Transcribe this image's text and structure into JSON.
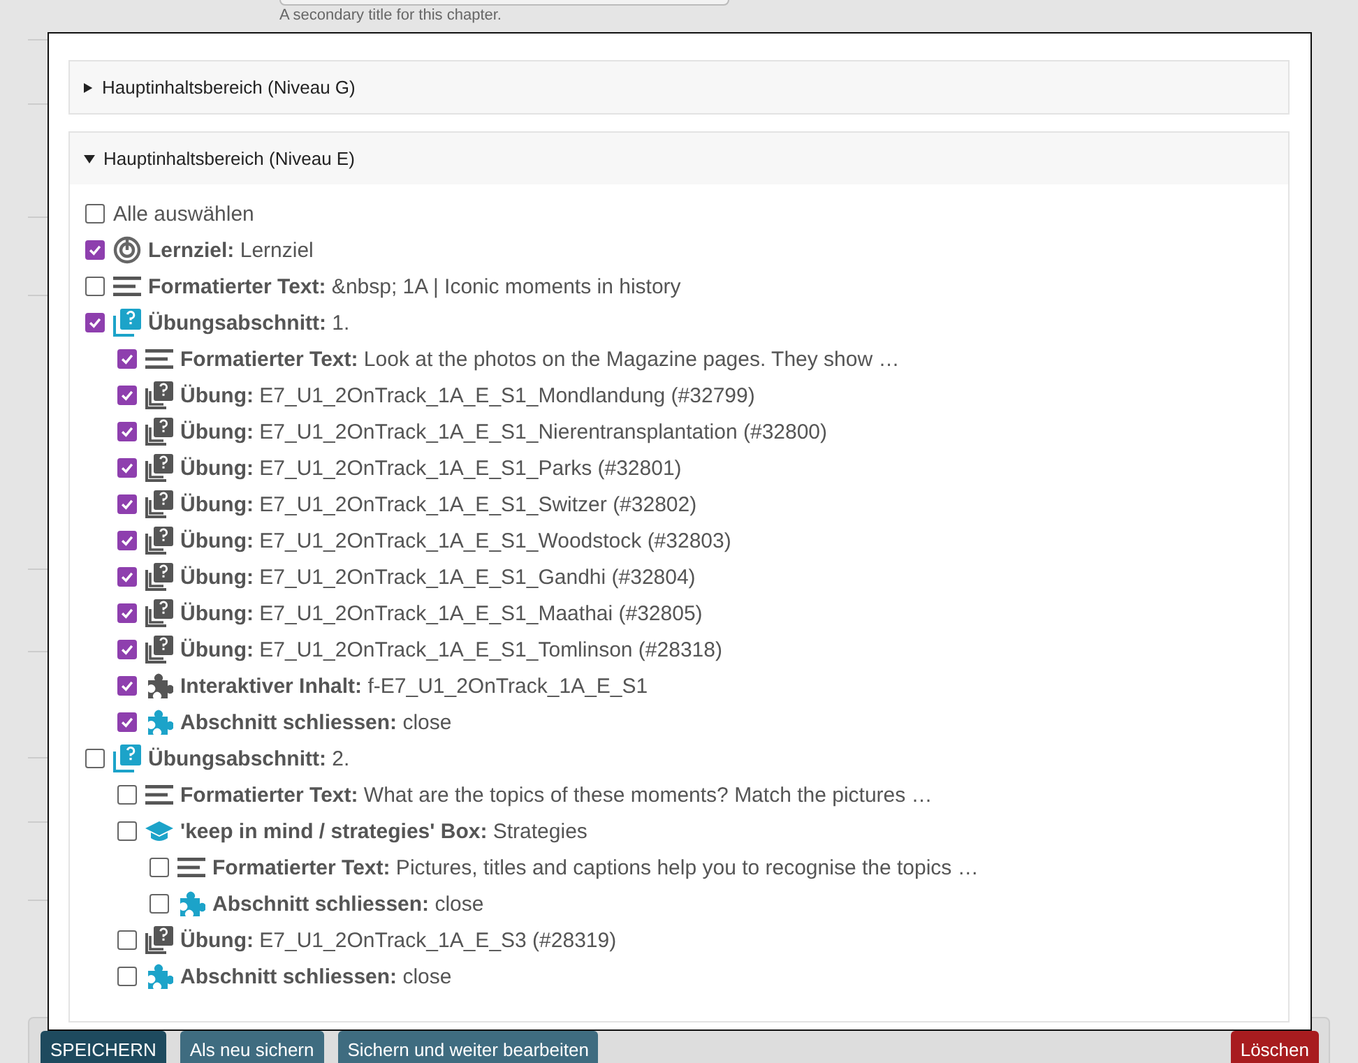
{
  "background": {
    "field_hint": "A secondary title for this chapter."
  },
  "dialog": {
    "sections": [
      {
        "title": "Hauptinhaltsbereich (Niveau G)",
        "expanded": false
      },
      {
        "title": "Hauptinhaltsbereich (Niveau E)",
        "expanded": true,
        "select_all": {
          "label": "Alle auswählen",
          "checked": false
        },
        "items": [
          {
            "kind": "learning-goal",
            "label": "Lernziel:",
            "value": "Lernziel",
            "checked": true
          },
          {
            "kind": "text",
            "label": "Formatierter Text:",
            "value": "&nbsp; 1A | Iconic moments in history",
            "checked": false
          },
          {
            "kind": "section",
            "label": "Übungsabschnitt:",
            "value": "1.",
            "checked": true,
            "children": [
              {
                "kind": "text",
                "label": "Formatierter Text:",
                "value": "Look at the photos on the Magazine pages. They show …",
                "checked": true
              },
              {
                "kind": "exercise",
                "label": "Übung:",
                "value": "E7_U1_2OnTrack_1A_E_S1_Mondlandung (#32799)",
                "checked": true
              },
              {
                "kind": "exercise",
                "label": "Übung:",
                "value": "E7_U1_2OnTrack_1A_E_S1_Nierentransplantation (#32800)",
                "checked": true
              },
              {
                "kind": "exercise",
                "label": "Übung:",
                "value": "E7_U1_2OnTrack_1A_E_S1_Parks (#32801)",
                "checked": true
              },
              {
                "kind": "exercise",
                "label": "Übung:",
                "value": "E7_U1_2OnTrack_1A_E_S1_Switzer (#32802)",
                "checked": true
              },
              {
                "kind": "exercise",
                "label": "Übung:",
                "value": "E7_U1_2OnTrack_1A_E_S1_Woodstock (#32803)",
                "checked": true
              },
              {
                "kind": "exercise",
                "label": "Übung:",
                "value": "E7_U1_2OnTrack_1A_E_S1_Gandhi (#32804)",
                "checked": true
              },
              {
                "kind": "exercise",
                "label": "Übung:",
                "value": "E7_U1_2OnTrack_1A_E_S1_Maathai (#32805)",
                "checked": true
              },
              {
                "kind": "exercise",
                "label": "Übung:",
                "value": "E7_U1_2OnTrack_1A_E_S1_Tomlinson (#28318)",
                "checked": true
              },
              {
                "kind": "interactive",
                "label": "Interaktiver Inhalt:",
                "value": "f-E7_U1_2OnTrack_1A_E_S1",
                "checked": true
              },
              {
                "kind": "close",
                "label": "Abschnitt schliessen:",
                "value": "close",
                "checked": true
              }
            ]
          },
          {
            "kind": "section",
            "label": "Übungsabschnitt:",
            "value": "2.",
            "checked": false,
            "children": [
              {
                "kind": "text",
                "label": "Formatierter Text:",
                "value": "What are the topics of these moments? Match the pictures …",
                "checked": false
              },
              {
                "kind": "box",
                "label": "'keep in mind / strategies' Box:",
                "value": "Strategies",
                "checked": false,
                "children": [
                  {
                    "kind": "text",
                    "label": "Formatierter Text:",
                    "value": "Pictures, titles and captions help you to recognise the topics …",
                    "checked": false
                  },
                  {
                    "kind": "close",
                    "label": "Abschnitt schliessen:",
                    "value": "close",
                    "checked": false
                  }
                ]
              },
              {
                "kind": "exercise",
                "label": "Übung:",
                "value": "E7_U1_2OnTrack_1A_E_S3 (#28319)",
                "checked": false
              },
              {
                "kind": "close",
                "label": "Abschnitt schliessen:",
                "value": "close",
                "checked": false
              }
            ]
          }
        ]
      }
    ]
  },
  "footer": {
    "buttons": [
      {
        "label": "SPEICHERN",
        "kind": "primary"
      },
      {
        "label": "Als neu sichern",
        "kind": "secondary"
      },
      {
        "label": "Sichern und weiter bearbeiten",
        "kind": "secondary"
      },
      {
        "label": "Löschen",
        "kind": "danger"
      }
    ]
  }
}
